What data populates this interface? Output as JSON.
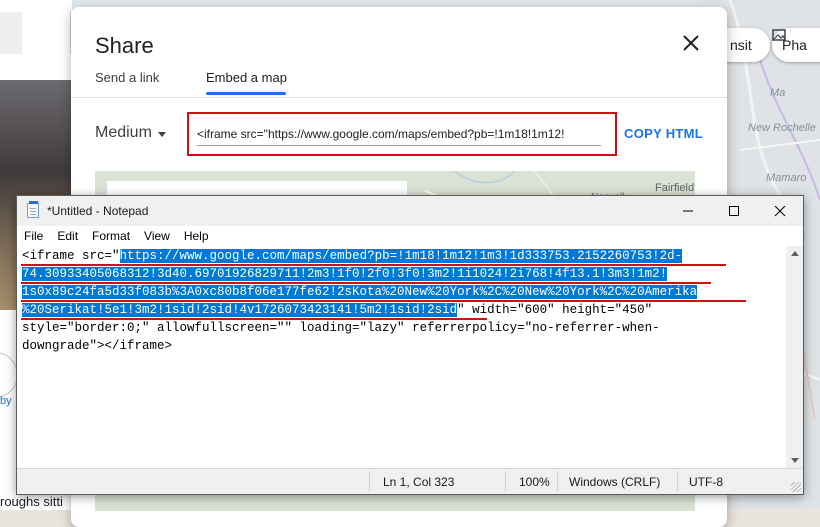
{
  "background": {
    "chip_transit": "nsit",
    "chip_photos": "Pha",
    "place_1": "Ma",
    "place_2": "New Rochelle",
    "place_3": "Mamaro",
    "side_label": "by",
    "side_text": "roughs sitti"
  },
  "share_dialog": {
    "title": "Share",
    "tabs": [
      {
        "label": "Send a link",
        "selected": false
      },
      {
        "label": "Embed a map",
        "selected": true
      }
    ],
    "size_selected": "Medium",
    "embed_code": "<iframe src=\"https://www.google.com/maps/embed?pb=!1m18!1m12!",
    "copy_button": "COPY HTML",
    "map_labels": {
      "fairfield": "Fairfield",
      "norwalk": "Norwalk"
    },
    "accent_color": "#1a73e8",
    "highlight_color": "#d01010"
  },
  "notepad": {
    "title": "*Untitled - Notepad",
    "menu": [
      "File",
      "Edit",
      "Format",
      "View",
      "Help"
    ],
    "lines": [
      {
        "pre": "<iframe src=\"",
        "sel": "https://www.google.com/maps/embed?pb=!1m18!1m12!1m3!1d333753.2152260753!2d-",
        "post": ""
      },
      {
        "pre": "",
        "sel": "74.30933405068312!3d40.69701926829711!2m3!1f0!2f0!3f0!3m2!1i1024!2i768!4f13.1!3m3!1m2!",
        "post": ""
      },
      {
        "pre": "",
        "sel": "1s0x89c24fa5d33f083b%3A0xc80b8f06e177fe62!2sKota%20New%20York%2C%20New%20York%2C%20Amerika",
        "post": ""
      },
      {
        "pre": "",
        "sel": "%20Serikat!5e1!3m2!1sid!2sid!4v1726073423141!5m2!1sid!2sid",
        "post": "\" width=\"600\" height=\"450\""
      },
      {
        "pre": "style=\"border:0;\" allowfullscreen=\"\" loading=\"lazy\" referrerpolicy=\"no-referrer-when-",
        "sel": "",
        "post": ""
      },
      {
        "pre": "downgrade\"></iframe>",
        "sel": "",
        "post": ""
      }
    ],
    "status": {
      "position": "Ln 1, Col 323",
      "zoom": "100%",
      "line_ending": "Windows (CRLF)",
      "encoding": "UTF-8"
    },
    "selection_color": "#0078d7"
  }
}
